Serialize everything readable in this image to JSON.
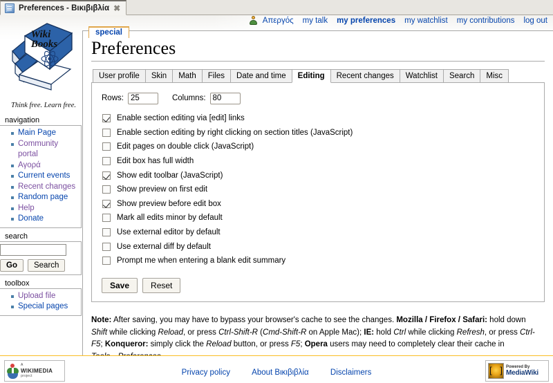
{
  "browser": {
    "tab_title": "Preferences - Βικιβιβλία",
    "favicon": "wikibooks-favicon",
    "close_glyph": "✖"
  },
  "personal_bar": {
    "user_icon": "user-icon",
    "links": [
      {
        "label": "Απεργός",
        "active": false
      },
      {
        "label": "my talk",
        "active": false
      },
      {
        "label": "my preferences",
        "active": true
      },
      {
        "label": "my watchlist",
        "active": false
      },
      {
        "label": "my contributions",
        "active": false
      },
      {
        "label": "log out",
        "active": false
      }
    ]
  },
  "sidebar": {
    "logo_line1": "Wiki",
    "logo_line2": "Books",
    "tagline": "Think free. Learn free.",
    "navigation": {
      "heading": "navigation",
      "items": [
        {
          "label": "Main Page",
          "visited": false
        },
        {
          "label": "Community portal",
          "visited": true
        },
        {
          "label": "Αγορά",
          "visited": true
        },
        {
          "label": "Current events",
          "visited": false
        },
        {
          "label": "Recent changes",
          "visited": true
        },
        {
          "label": "Random page",
          "visited": false
        },
        {
          "label": "Help",
          "visited": true
        },
        {
          "label": "Donate",
          "visited": false
        }
      ]
    },
    "search": {
      "heading": "search",
      "value": "",
      "placeholder": "",
      "go_label": "Go",
      "search_label": "Search"
    },
    "toolbox": {
      "heading": "toolbox",
      "items": [
        {
          "label": "Upload file",
          "visited": true
        },
        {
          "label": "Special pages",
          "visited": false
        }
      ]
    }
  },
  "content": {
    "namespace_tab": "special",
    "page_title": "Preferences",
    "tabs": [
      {
        "label": "User profile",
        "selected": false
      },
      {
        "label": "Skin",
        "selected": false
      },
      {
        "label": "Math",
        "selected": false
      },
      {
        "label": "Files",
        "selected": false
      },
      {
        "label": "Date and time",
        "selected": false
      },
      {
        "label": "Editing",
        "selected": true
      },
      {
        "label": "Recent changes",
        "selected": false
      },
      {
        "label": "Watchlist",
        "selected": false
      },
      {
        "label": "Search",
        "selected": false
      },
      {
        "label": "Misc",
        "selected": false
      }
    ],
    "rows_label": "Rows:",
    "rows_value": "25",
    "cols_label": "Columns:",
    "cols_value": "80",
    "options": [
      {
        "label": "Enable section editing via [edit] links",
        "checked": true
      },
      {
        "label": "Enable section editing by right clicking on section titles (JavaScript)",
        "checked": false
      },
      {
        "label": "Edit pages on double click (JavaScript)",
        "checked": false
      },
      {
        "label": "Edit box has full width",
        "checked": false
      },
      {
        "label": "Show edit toolbar (JavaScript)",
        "checked": true
      },
      {
        "label": "Show preview on first edit",
        "checked": false
      },
      {
        "label": "Show preview before edit box",
        "checked": true
      },
      {
        "label": "Mark all edits minor by default",
        "checked": false
      },
      {
        "label": "Use external editor by default",
        "checked": false
      },
      {
        "label": "Use external diff by default",
        "checked": false
      },
      {
        "label": "Prompt me when entering a blank edit summary",
        "checked": false
      }
    ],
    "save_label": "Save",
    "reset_label": "Reset",
    "note": {
      "prefix_bold": "Note:",
      "t1": " After saving, you may have to bypass your browser's cache to see the changes. ",
      "b1": "Mozilla / Firefox / Safari:",
      "t2": " hold down ",
      "i1": "Shift",
      "t3": " while clicking ",
      "i2": "Reload",
      "t4": ", or press ",
      "i3": "Ctrl-Shift-R",
      "t5": " (",
      "i4": "Cmd-Shift-R",
      "t6": " on Apple Mac); ",
      "b2": "IE:",
      "t7": " hold ",
      "i5": "Ctrl",
      "t8": " while clicking ",
      "i6": "Refresh",
      "t9": ", or press ",
      "i7": "Ctrl-F5",
      "t10": "; ",
      "b3": "Konqueror:",
      "t11": " simply click the ",
      "i8": "Reload",
      "t12": " button, or press ",
      "i9": "F5",
      "t13": "; ",
      "b4": "Opera",
      "t14": " users may need to completely clear their cache in ",
      "i10": "Tools→Preferences",
      "t15": "."
    }
  },
  "footer": {
    "links": [
      {
        "label": "Privacy policy"
      },
      {
        "label": "About Βικιβιβλία"
      },
      {
        "label": "Disclaimers"
      }
    ],
    "wikimedia_badge": {
      "line1": "A",
      "line2": "WIKIMEDIA",
      "line3": "project"
    },
    "mediawiki_badge": {
      "line1": "Powered By",
      "line2": "MediaWiki"
    }
  }
}
